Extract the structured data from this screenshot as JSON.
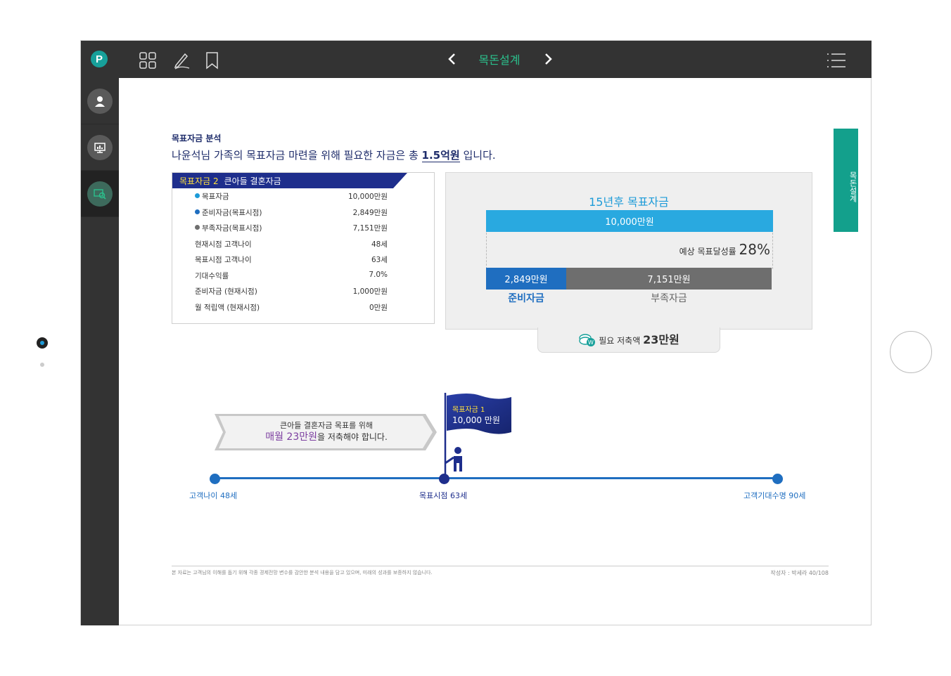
{
  "nav": {
    "title": "목돈설계"
  },
  "side_tab": "목돈설계",
  "section": {
    "title": "목표자금 분석",
    "subtitle_pre": "나윤석님 가족의 목표자금 마련을 위해 필요한 자금은 총 ",
    "subtitle_em": "1.5억원",
    "subtitle_post": " 입니다."
  },
  "info": {
    "head_tag": "목표자금 2",
    "head_title": "큰아들 결혼자금",
    "rows": [
      {
        "label": "목표자금",
        "value": "10,000만원",
        "dot": "#1d9bd8"
      },
      {
        "label": "준비자금(목표시점)",
        "value": "2,849만원",
        "dot": "#1f6ec0"
      },
      {
        "label": "부족자금(목표시점)",
        "value": "7,151만원",
        "dot": "#6e6e6e"
      },
      {
        "label": "현재시점 고객나이",
        "value": "48세"
      },
      {
        "label": "목표시점 고객나이",
        "value": "63세"
      },
      {
        "label": "기대수익률",
        "value": "7.0%"
      },
      {
        "label": "준비자금 (현재시점)",
        "value": "1,000만원"
      },
      {
        "label": "월 적립액 (현재시점)",
        "value": "0만원"
      }
    ]
  },
  "goal": {
    "title": "15년후 목표자금",
    "target": "10,000만원",
    "rate_label": "예상 목표달성률",
    "rate_value": "28%",
    "reserve_amount": "2,849만원",
    "lack_amount": "7,151만원",
    "reserve_label": "준비자금",
    "lack_label": "부족자금",
    "saving_label": "필요 저축액",
    "saving_value": "23만원",
    "reserve_fraction": 0.2849
  },
  "message": {
    "line1": "큰아들 결혼자금 목표를 위해",
    "line2_hl": "매월 23만원",
    "line2_post": "을 저축해야 합니다."
  },
  "flag": {
    "tag": "목표자금 1",
    "amount": "10,000 만원"
  },
  "timeline": {
    "start": "고객나이 48세",
    "mid": "목표시점 63세",
    "end": "고객기대수명 90세"
  },
  "footer": {
    "disclaimer": "본 자료는 고객님의 이해를 돕기 위해 각종 경제전망 변수를 감안한 분석 내용을 담고 있으며, 미래의 성과를 보증하지 않습니다.",
    "right": "작성자 : 박세라 40/108"
  },
  "colors": {
    "accent": "#2bc08c",
    "navy": "#1e2e8c",
    "blue": "#1f6ec0",
    "sky": "#29a9e0"
  }
}
